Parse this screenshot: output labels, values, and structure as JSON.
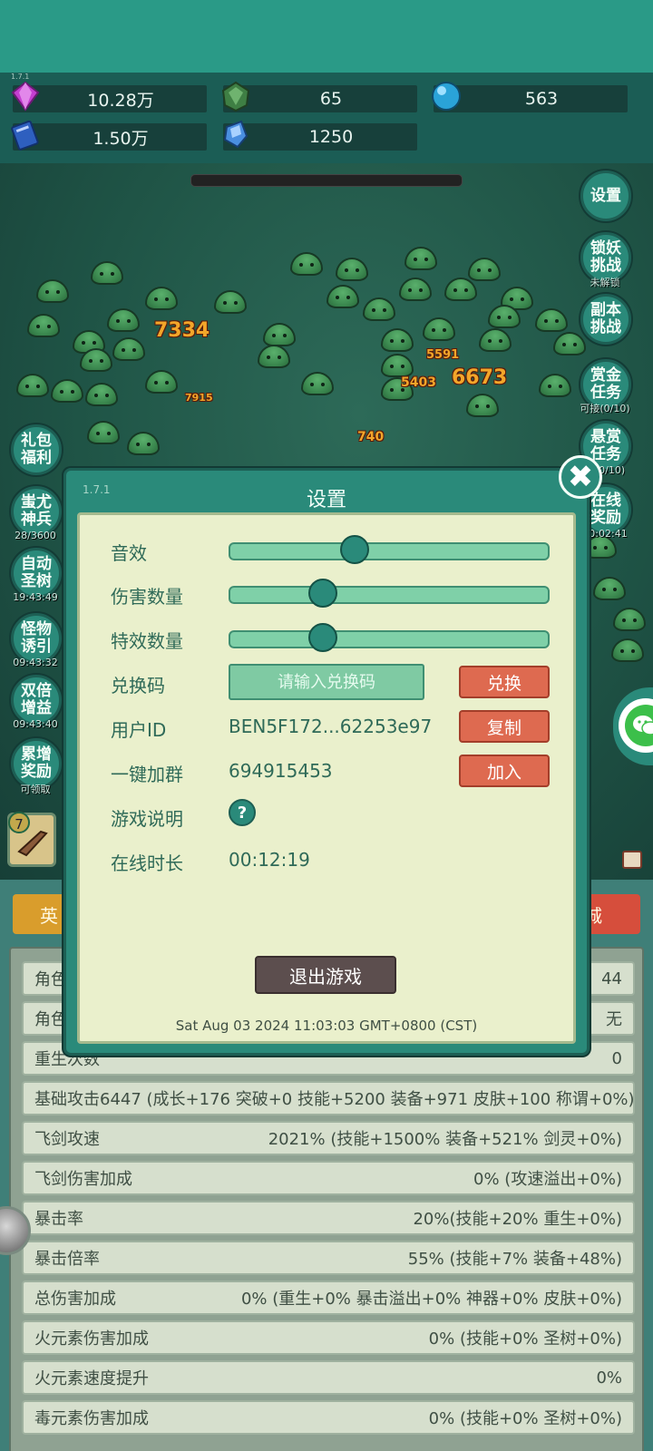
{
  "version_small": "1.7.1",
  "resources": [
    {
      "icon": "gem-icon",
      "value": "10.28万",
      "color": "#c53fd1"
    },
    {
      "icon": "stone-icon",
      "value": "65",
      "color": "#3f7f44"
    },
    {
      "icon": "orb-icon",
      "value": "563",
      "color": "#2aa3d8"
    },
    {
      "icon": "book-icon",
      "value": "1.50万",
      "color": "#2e5fbf"
    },
    {
      "icon": "crystal-icon",
      "value": "1250",
      "color": "#4a8fe0"
    }
  ],
  "right_buttons": [
    {
      "label": "设置",
      "caption": ""
    },
    {
      "label": "锁妖\n挑战",
      "caption": "未解锁"
    },
    {
      "label": "副本\n挑战",
      "caption": ""
    },
    {
      "label": "赏金\n任务",
      "caption": "可接(0/10)"
    },
    {
      "label": "悬赏\n任务",
      "caption": "接(0/10)"
    },
    {
      "label": "在线\n奖励",
      "caption": "00:02:41"
    }
  ],
  "left_buttons": [
    {
      "label": "礼包\n福利",
      "caption": ""
    },
    {
      "label": "蚩尤\n神兵",
      "caption": "28/3600"
    },
    {
      "label": "自动\n圣树",
      "caption": "19:43:49"
    },
    {
      "label": "怪物\n诱引",
      "caption": "09:43:32"
    },
    {
      "label": "双倍\n增益",
      "caption": "09:43:40"
    },
    {
      "label": "累增\n奖励",
      "caption": "可领取"
    }
  ],
  "damage_numbers": [
    "7334",
    "7915",
    "5591",
    "5403",
    "6673",
    "740"
  ],
  "item_slot_badge": "7",
  "bottom_tabs": {
    "left": "英",
    "right": "城"
  },
  "stats": [
    {
      "label": "角色",
      "value": "44"
    },
    {
      "label": "角色",
      "value": "无"
    },
    {
      "label": "重生次数",
      "value": "0"
    },
    {
      "label": "基础攻击6447 (成长+176 突破+0 技能+5200 装备+971 皮肤+100 称谓+0%)",
      "value": ""
    },
    {
      "label": "飞剑攻速",
      "value": "2021% (技能+1500% 装备+521% 剑灵+0%)"
    },
    {
      "label": "飞剑伤害加成",
      "value": "0% (攻速溢出+0%)"
    },
    {
      "label": "暴击率",
      "value": "20%(技能+20% 重生+0%)"
    },
    {
      "label": "暴击倍率",
      "value": "55% (技能+7% 装备+48%)"
    },
    {
      "label": "总伤害加成",
      "value": "0% (重生+0% 暴击溢出+0% 神器+0% 皮肤+0%)"
    },
    {
      "label": "火元素伤害加成",
      "value": "0% (技能+0% 圣树+0%)"
    },
    {
      "label": "火元素速度提升",
      "value": "0%"
    },
    {
      "label": "毒元素伤害加成",
      "value": "0% (技能+0% 圣树+0%)"
    }
  ],
  "settings": {
    "title": "设置",
    "version": "1.7.1",
    "sound_label": "音效",
    "sound_level": 0.39,
    "damage_count_label": "伤害数量",
    "damage_count_level": 0.29,
    "effects_count_label": "特效数量",
    "effects_count_level": 0.29,
    "redeem_label": "兑换码",
    "redeem_placeholder": "请输入兑换码",
    "redeem_button": "兑换",
    "user_id_label": "用户ID",
    "user_id_value": "BEN5F172...62253e97",
    "copy_button": "复制",
    "join_group_label": "一键加群",
    "join_group_value": "694915453",
    "join_button": "加入",
    "game_help_label": "游戏说明",
    "help_glyph": "?",
    "online_time_label": "在线时长",
    "online_time_value": "00:12:19",
    "exit_button": "退出游戏",
    "timestamp": "Sat Aug 03 2024 11:03:03 GMT+0800 (CST)",
    "close_glyph": "✖"
  }
}
